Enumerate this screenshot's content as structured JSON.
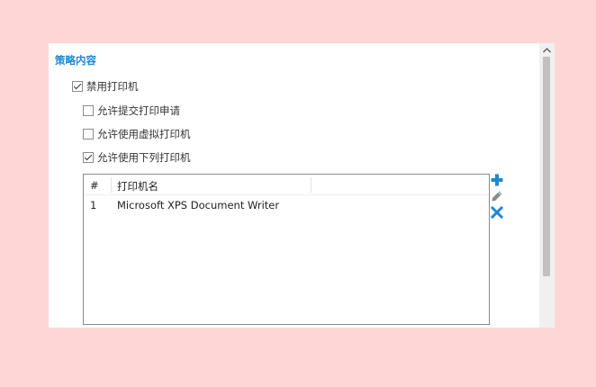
{
  "section": {
    "title": "策略内容"
  },
  "options": {
    "disable_printer": {
      "label": "禁用打印机",
      "checked": true
    },
    "allow_submit_request": {
      "label": "允许提交打印申请",
      "checked": false
    },
    "allow_virtual_printer": {
      "label": "允许使用虚拟打印机",
      "checked": false
    },
    "allow_listed_printers": {
      "label": "允许使用下列打印机",
      "checked": true
    }
  },
  "printer_table": {
    "columns": {
      "index": "#",
      "name": "打印机名"
    },
    "rows": [
      {
        "index": "1",
        "name": "Microsoft XPS Document Writer"
      }
    ]
  },
  "actions": {
    "add_icon": "plus-icon",
    "edit_icon": "pencil-icon",
    "delete_icon": "x-icon"
  },
  "colors": {
    "accent": "#1e88d2",
    "background": "#ffd6d6",
    "edit_icon": "#8a8a8a"
  }
}
